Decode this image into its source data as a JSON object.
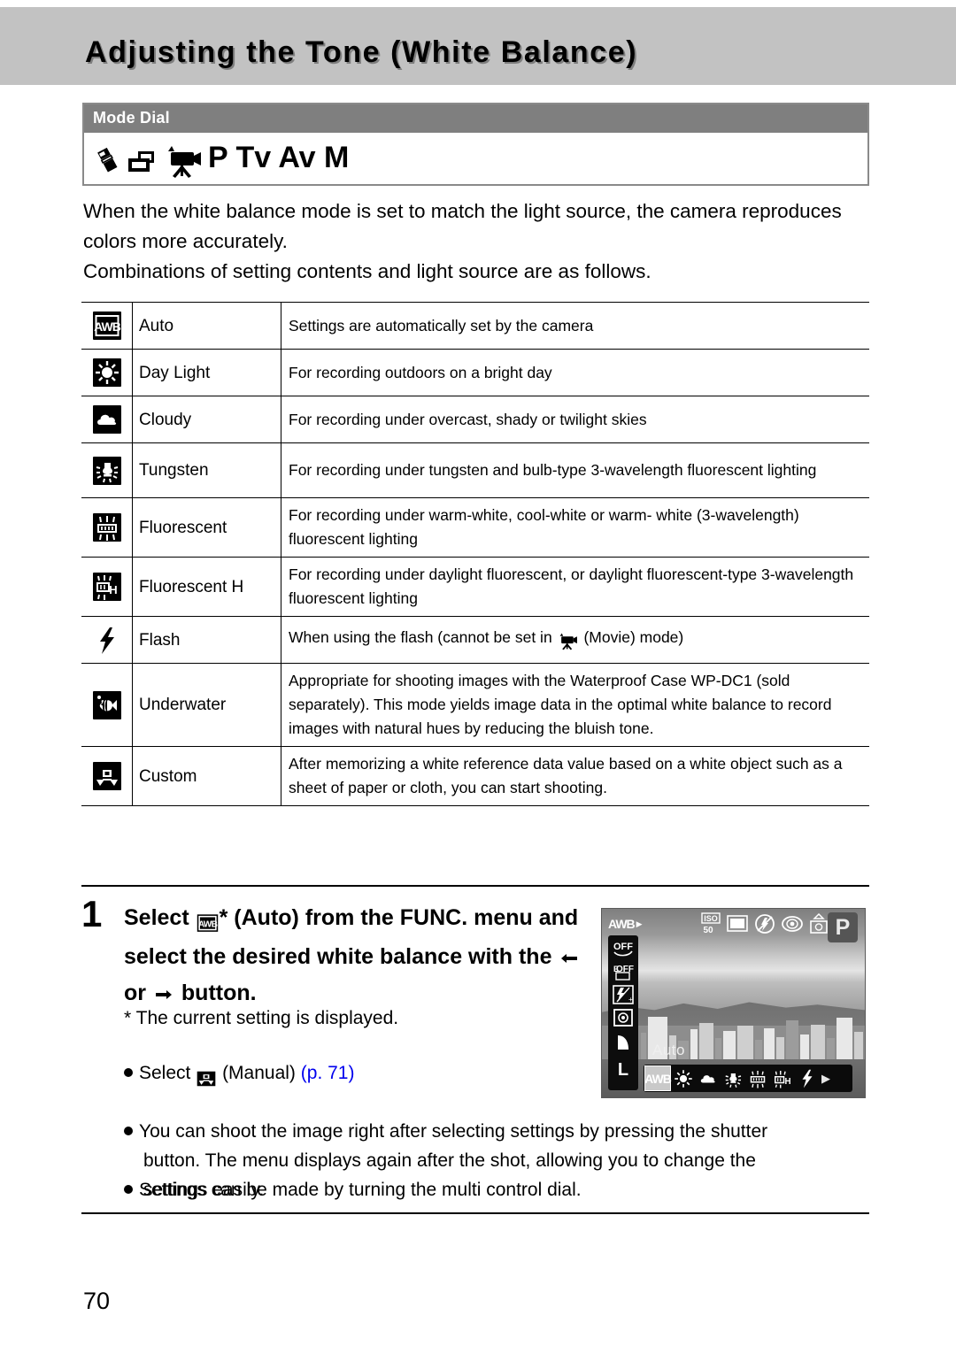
{
  "page": {
    "title": "Adjusting the Tone (White Balance)",
    "number": "70"
  },
  "mode_dial": {
    "label": "Mode Dial",
    "icons": [
      "stitch-assist-icon",
      "digital-macro-icon",
      "movie-icon"
    ],
    "modes": "P Tv Av M"
  },
  "intro": {
    "line1": "When the white balance mode is set to match the light source, the camera reproduces colors more accurately.",
    "line2": "Combinations of setting contents and light source are as follows."
  },
  "table": {
    "rows": [
      {
        "icon": "awb-icon",
        "name": "Auto",
        "desc": "Settings are automatically set by the camera"
      },
      {
        "icon": "day-light-icon",
        "name": "Day Light",
        "desc": "For recording outdoors on a bright day"
      },
      {
        "icon": "cloudy-icon",
        "name": "Cloudy",
        "desc": "For recording under overcast, shady or twilight skies"
      },
      {
        "icon": "tungsten-icon",
        "name": "Tungsten",
        "desc": "For recording under tungsten and bulb-type 3-wavelength fluorescent lighting"
      },
      {
        "icon": "fluorescent-icon",
        "name": "Fluorescent",
        "desc": "For recording under warm-white, cool-white or warm- white (3-wavelength) fluorescent lighting"
      },
      {
        "icon": "fluorescent-h-icon",
        "name": "Fluorescent H",
        "desc": "For recording under daylight fluorescent, or daylight fluorescent-type 3-wavelength fluorescent lighting"
      },
      {
        "icon": "flash-icon",
        "name": "Flash",
        "desc_before": "When using the flash (cannot be set in",
        "desc_icon": "movie-icon",
        "desc_after": "(Movie) mode)"
      },
      {
        "icon": "underwater-icon",
        "name": "Underwater",
        "desc": "Appropriate for shooting images with the Waterproof Case WP-DC1 (sold separately). This mode yields image data in the optimal white balance to record images with natural hues by reducing the bluish tone."
      },
      {
        "icon": "custom-icon",
        "name": "Custom",
        "desc": "After memorizing a white reference data value based on a white object such as a sheet of paper or cloth, you can start shooting."
      }
    ]
  },
  "step": {
    "number": "1",
    "head_a": "Select",
    "head_icon": "awb-icon",
    "head_b": "* (Auto) from the FUNC. menu and select the desired white balance with the",
    "head_left_arrow": "left-arrow-icon",
    "head_or": "or",
    "head_right_arrow": "right-arrow-icon",
    "head_c": "button.",
    "footnote": "* The current setting is displayed.",
    "bullet1_a": "Select",
    "bullet1_icon": "custom-icon",
    "bullet1_b": "(Manual)",
    "bullet1_link": "(p. 71)",
    "bullet2": "You can shoot the image right after selecting settings by pressing the shutter button. The menu displays again after the shot, allowing you to change the settings easily.",
    "bullet3": "Settings can be made by turning the multi control dial."
  },
  "lcd": {
    "wb_indicator": "AWB",
    "top_icons": [
      "iso-50-icon",
      "frame-icon",
      "flash-off-icon",
      "red-eye-icon",
      "camera-shake-icon"
    ],
    "iso_label": "ISO",
    "iso_value": "50",
    "mode_badge": "P",
    "left_items": [
      "my-colors-off-icon",
      "exposure-bracket-off-icon",
      "flash-exposure-icon",
      "metering-icon",
      "compression-icon",
      "resolution-l-icon"
    ],
    "compression_label": "L",
    "wb_name": "Auto",
    "menu_selected": "AWB",
    "menu_items": [
      "day-light-icon",
      "cloudy-icon",
      "tungsten-icon",
      "fluorescent-icon",
      "fluorescent-h-icon",
      "flash-icon"
    ],
    "menu_next": "next-arrow-icon"
  },
  "colors": {
    "title_band": "#c2c2c2",
    "mode_dial_header": "#7f7f7f",
    "link": "#0000ee",
    "text": "#000000"
  }
}
